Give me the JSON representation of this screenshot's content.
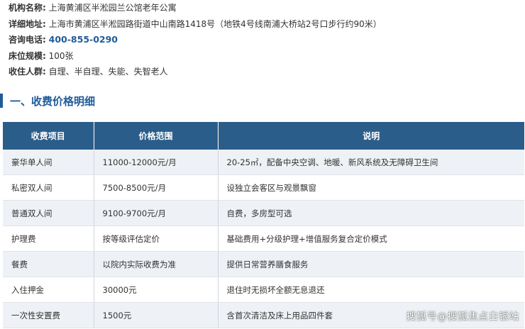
{
  "info": {
    "name_label": "机构名称:",
    "name_value": "上海黄浦区半淞园兰公馆老年公寓",
    "address_label": "详细地址:",
    "address_value": "上海市黄浦区半淞园路街道中山南路1418号（地铁4号线南浦大桥站2号口步行约90米）",
    "phone_label": "咨询电话:",
    "phone_value": "400-855-0290",
    "beds_label": "床位规模:",
    "beds_value": "100张",
    "target_label": "收住人群:",
    "target_value": "自理、半自理、失能、失智老人"
  },
  "section": {
    "title": "一、收费价格明细"
  },
  "table": {
    "headers": [
      "收费项目",
      "价格范围",
      "说明"
    ],
    "rows": [
      {
        "item": "豪华单人间",
        "price": "11000-12000元/月",
        "desc": "20-25㎡，配备中央空调、地暖、新风系统及无障碍卫生间"
      },
      {
        "item": "私密双人间",
        "price": "7500-8500元/月",
        "desc": "设独立会客区与观景飘窗"
      },
      {
        "item": "普通双人间",
        "price": "9100-9700元/月",
        "desc": "自费，多房型可选"
      },
      {
        "item": "护理费",
        "price": "按等级评估定价",
        "desc": "基础费用+分级护理+增值服务复合定价模式"
      },
      {
        "item": "餐费",
        "price": "以院内实际收费为准",
        "desc": "提供日常营养膳食服务"
      },
      {
        "item": "入住押金",
        "price": "30000元",
        "desc": "退住时无损坏全额无息退还"
      },
      {
        "item": "一次性安置费",
        "price": "1500元",
        "desc": "含首次清洁及床上用品四件套"
      }
    ]
  },
  "watermark": "搜狐号@搜狐焦点白银站",
  "colors": {
    "accent": "#1f5b99",
    "header_bg": "#2b5d8a",
    "row_alt": "#eef2f6"
  }
}
